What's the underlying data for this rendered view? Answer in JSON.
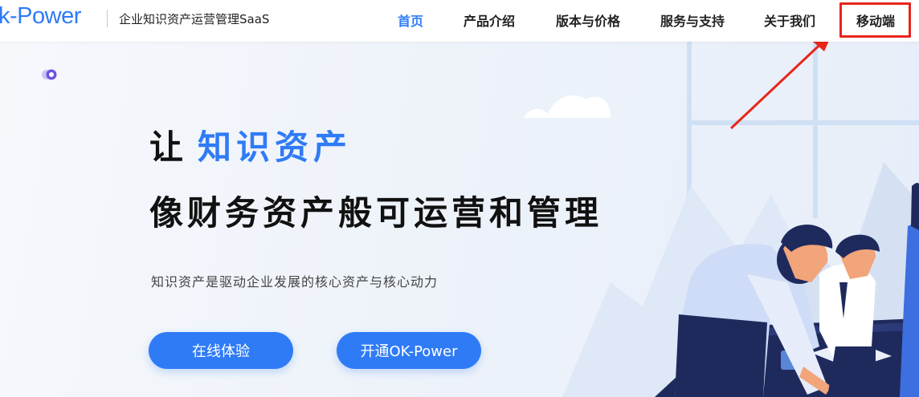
{
  "header": {
    "logo_text": "k-Power",
    "tagline": "企业知识资产运营管理SaaS",
    "nav": [
      {
        "label": "首页",
        "active": true
      },
      {
        "label": "产品介绍"
      },
      {
        "label": "版本与价格"
      },
      {
        "label": "服务与支持"
      },
      {
        "label": "关于我们"
      },
      {
        "label": "移动端",
        "highlighted": true
      }
    ]
  },
  "hero": {
    "line1_prefix": "让",
    "line1_accent": "知识资产",
    "line2": "像财务资产般可运营和管理",
    "subtitle": "知识资产是驱动企业发展的核心资产与核心动力",
    "buttons": {
      "try_online": "在线体验",
      "activate": "开通OK-Power"
    }
  },
  "colors": {
    "brand_blue": "#2f7bf6",
    "annotation_red": "#e8251b",
    "navy": "#1f2a5c"
  },
  "icons": {
    "hero_dot": "ring-dot-icon",
    "annotation_arrow": "red-arrow-icon"
  }
}
